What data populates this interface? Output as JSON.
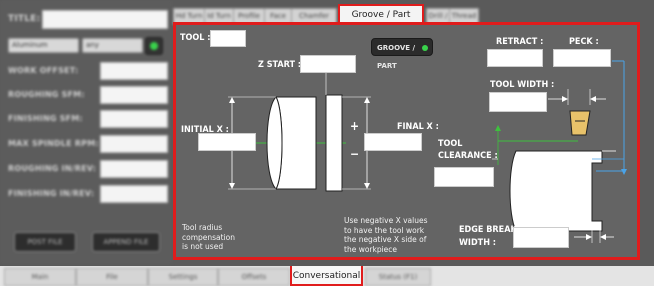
{
  "left": {
    "title_label": "TITLE:",
    "material": "Aluminum",
    "tool_select": "any",
    "rows": [
      "WORK OFFSET:",
      "ROUGHING SFM:",
      "FINISHING SFM:",
      "MAX SPINDLE RPM:",
      "ROUGHING IN/REV:",
      "FINISHING IN/REV:"
    ],
    "post_file_label": "POST FILE",
    "append_file_label": "APPEND FILE"
  },
  "top_tabs": [
    "Hd Turn",
    "Id Turn",
    "Profile",
    "Face",
    "Chamfer"
  ],
  "top_tabs_right": [
    "Drill / Tap",
    "Thread"
  ],
  "active_tab": "Groove / Part",
  "panel": {
    "tool_label": "TOOL :",
    "groove_part_button": "GROOVE / PART",
    "z_start_label": "Z START :",
    "initial_x_label": "INITIAL X :",
    "final_x_label": "FINAL X :",
    "retract_label": "RETRACT :",
    "peck_label": "PECK :",
    "tool_width_label": "TOOL WIDTH :",
    "tool_clearance_label1": "TOOL",
    "tool_clearance_label2": "CLEARANCE :",
    "edge_break_label1": "EDGE BREAK",
    "edge_break_label2": "WIDTH :",
    "plus": "+",
    "minus": "−",
    "note_left": [
      "Tool radius",
      "compensation",
      "is not used"
    ],
    "note_mid": [
      "Use negative X values",
      "to have the tool work",
      "the negative X side of",
      "the workpiece"
    ]
  },
  "bottom_tabs": [
    "Main",
    "File",
    "Settings",
    "Offsets"
  ],
  "bottom_tabs_right": [
    "Status (F1)"
  ],
  "active_bottom_tab": "Conversational",
  "colors": {
    "accent": "#e01c1c",
    "status_green": "#39d24b",
    "guide_blue": "#4aa3e8",
    "guide_green": "#3ec13e"
  }
}
